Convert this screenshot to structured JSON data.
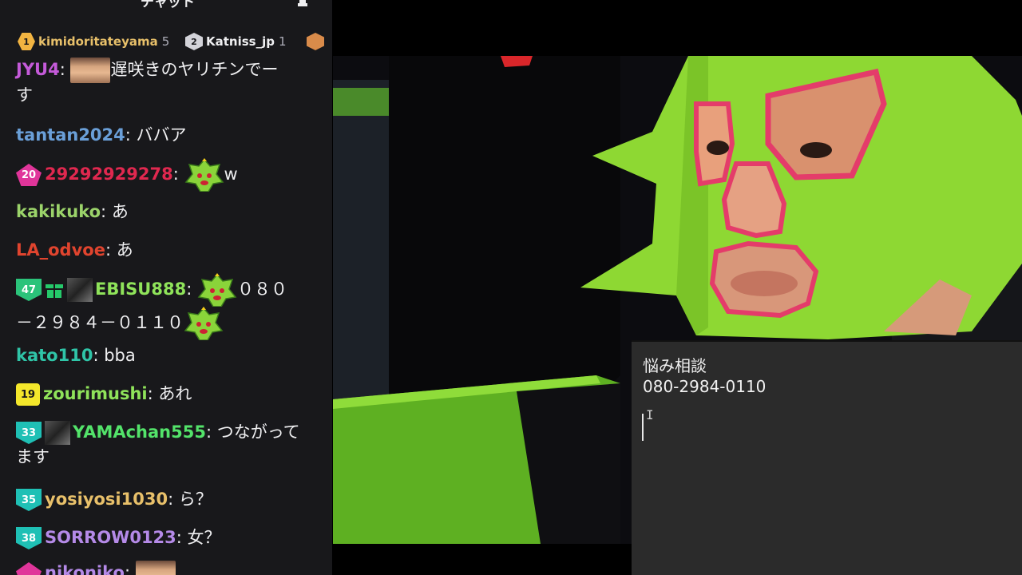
{
  "chat": {
    "title": "チャット",
    "leaderboard": [
      {
        "rank": "1",
        "name": "kimidoritateyama",
        "count": "5",
        "color": "#e8c06a"
      },
      {
        "rank": "2",
        "name": "Katniss_jp",
        "count": "1",
        "color": "#efeff1"
      }
    ],
    "messages": [
      {
        "user": "JYU4",
        "color": "#c45ad9",
        "text1": "遅咲きのヤリチンでー",
        "text2": "す"
      },
      {
        "user": "tantan2024",
        "color": "#6a9fd8",
        "text": "ババア"
      },
      {
        "badge": "20",
        "user": "29292929278",
        "color": "#e0284f",
        "text": "w"
      },
      {
        "user": "kakikuko",
        "color": "#9bd36a",
        "text": "あ"
      },
      {
        "user": "LA_odvoe",
        "color": "#e0442e",
        "text": "あ"
      },
      {
        "badge": "47",
        "user": "EBISU888",
        "color": "#8fe35a",
        "text1": "０８０",
        "text2": "－２９８４－０１１０"
      },
      {
        "user": "kato110",
        "color": "#2fc5a8",
        "text": "bba"
      },
      {
        "badge": "19",
        "user": "zourimushi",
        "color": "#8fe35a",
        "text": "あれ"
      },
      {
        "badge": "33",
        "user": "YAMAchan555",
        "color": "#53e36a",
        "text1": "つながって",
        "text2": "ます"
      },
      {
        "badge": "35",
        "user": "yosiyosi1030",
        "color": "#e8c06a",
        "text": "ら？"
      },
      {
        "badge": "38",
        "user": "SORROW0123",
        "color": "#b58ae8",
        "text": "女？"
      },
      {
        "user": "nikoniko",
        "color": "#b58ae8",
        "text": ""
      }
    ]
  },
  "memo": {
    "line1": "悩み相談",
    "line2": "080-2984-0110",
    "ibeam": "I"
  }
}
